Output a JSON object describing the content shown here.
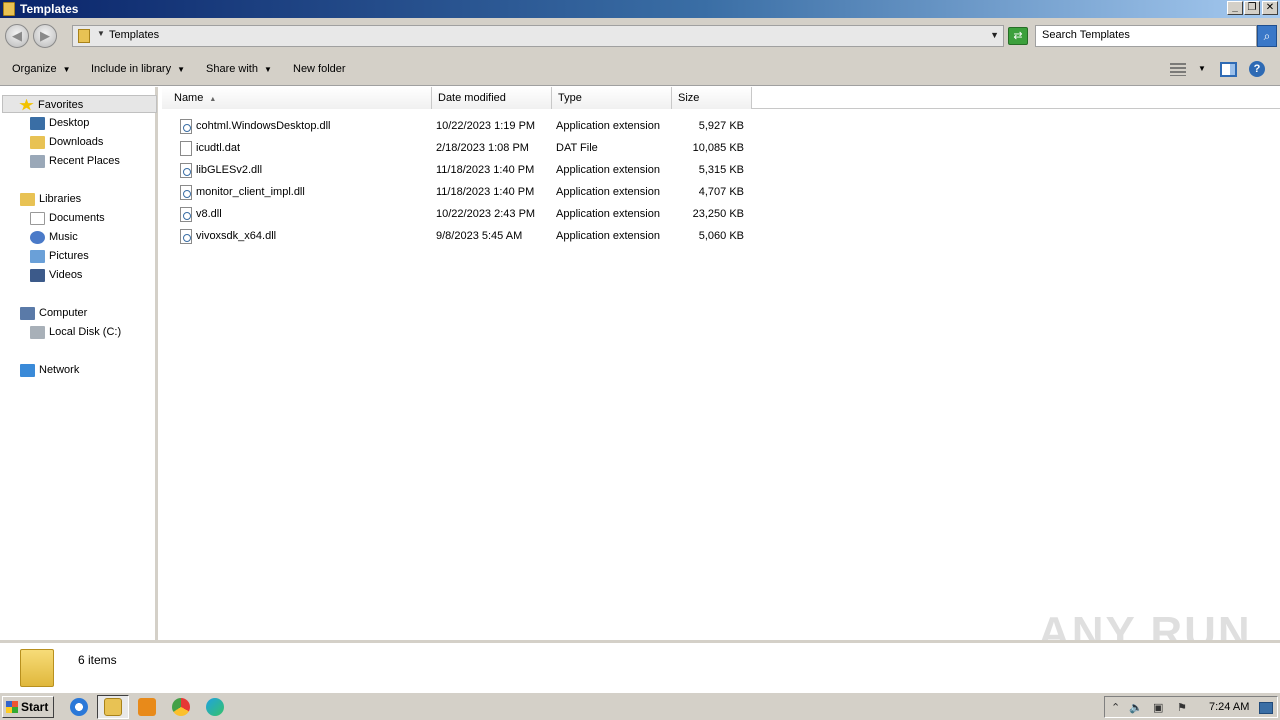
{
  "window": {
    "title": "Templates"
  },
  "address": {
    "path": "Templates",
    "search_placeholder": "Search Templates"
  },
  "toolbar": {
    "organize": "Organize",
    "include_in_library": "Include in library",
    "share_with": "Share with",
    "new_folder": "New folder"
  },
  "nav": {
    "favorites": "Favorites",
    "desktop": "Desktop",
    "downloads": "Downloads",
    "recent_places": "Recent Places",
    "libraries": "Libraries",
    "documents": "Documents",
    "music": "Music",
    "pictures": "Pictures",
    "videos": "Videos",
    "computer": "Computer",
    "local_disk": "Local Disk (C:)",
    "network": "Network"
  },
  "columns": {
    "name": "Name",
    "date": "Date modified",
    "type": "Type",
    "size": "Size"
  },
  "files": [
    {
      "name": "cohtml.WindowsDesktop.dll",
      "date": "10/22/2023 1:19 PM",
      "type": "Application extension",
      "size": "5,927 KB"
    },
    {
      "name": "icudtl.dat",
      "date": "2/18/2023 1:08 PM",
      "type": "DAT File",
      "size": "10,085 KB"
    },
    {
      "name": "libGLESv2.dll",
      "date": "11/18/2023 1:40 PM",
      "type": "Application extension",
      "size": "5,315 KB"
    },
    {
      "name": "monitor_client_impl.dll",
      "date": "11/18/2023 1:40 PM",
      "type": "Application extension",
      "size": "4,707 KB"
    },
    {
      "name": "v8.dll",
      "date": "10/22/2023 2:43 PM",
      "type": "Application extension",
      "size": "23,250 KB"
    },
    {
      "name": "vivoxsdk_x64.dll",
      "date": "9/8/2023 5:45 AM",
      "type": "Application extension",
      "size": "5,060 KB"
    }
  ],
  "status": {
    "count": "6 items"
  },
  "watermark": "ANY RUN",
  "taskbar": {
    "start": "Start",
    "clock": "7:24 AM"
  }
}
